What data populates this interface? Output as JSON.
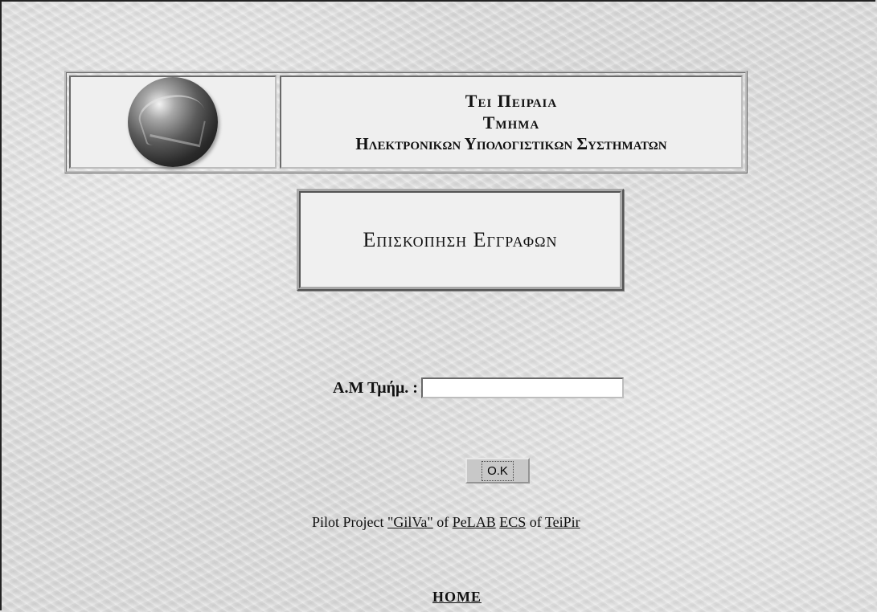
{
  "header": {
    "line1": "Τει Πειραια",
    "line2": "Τμημα",
    "line3": "Ηλεκτρονικων Υπολογιστικων Συστηματων",
    "logo_icon": "globe-logo-icon"
  },
  "page_title": "Επισκοπηση Εγγραφων",
  "form": {
    "label": "Α.Μ Τμήμ. :",
    "input_value": "",
    "submit_label": "O.K"
  },
  "footer": {
    "prefix": "Pilot Project ",
    "project_link": "\"GilVa\"",
    "of1": " of ",
    "lab_link": "PeLAB",
    "space": " ",
    "dept_link": "ECS",
    "of2": " of ",
    "inst_link": "TeiPir"
  },
  "home_link": "HOME",
  "colors": {
    "background": "#dcdcdc",
    "panel": "#efefef",
    "text": "#111111"
  }
}
